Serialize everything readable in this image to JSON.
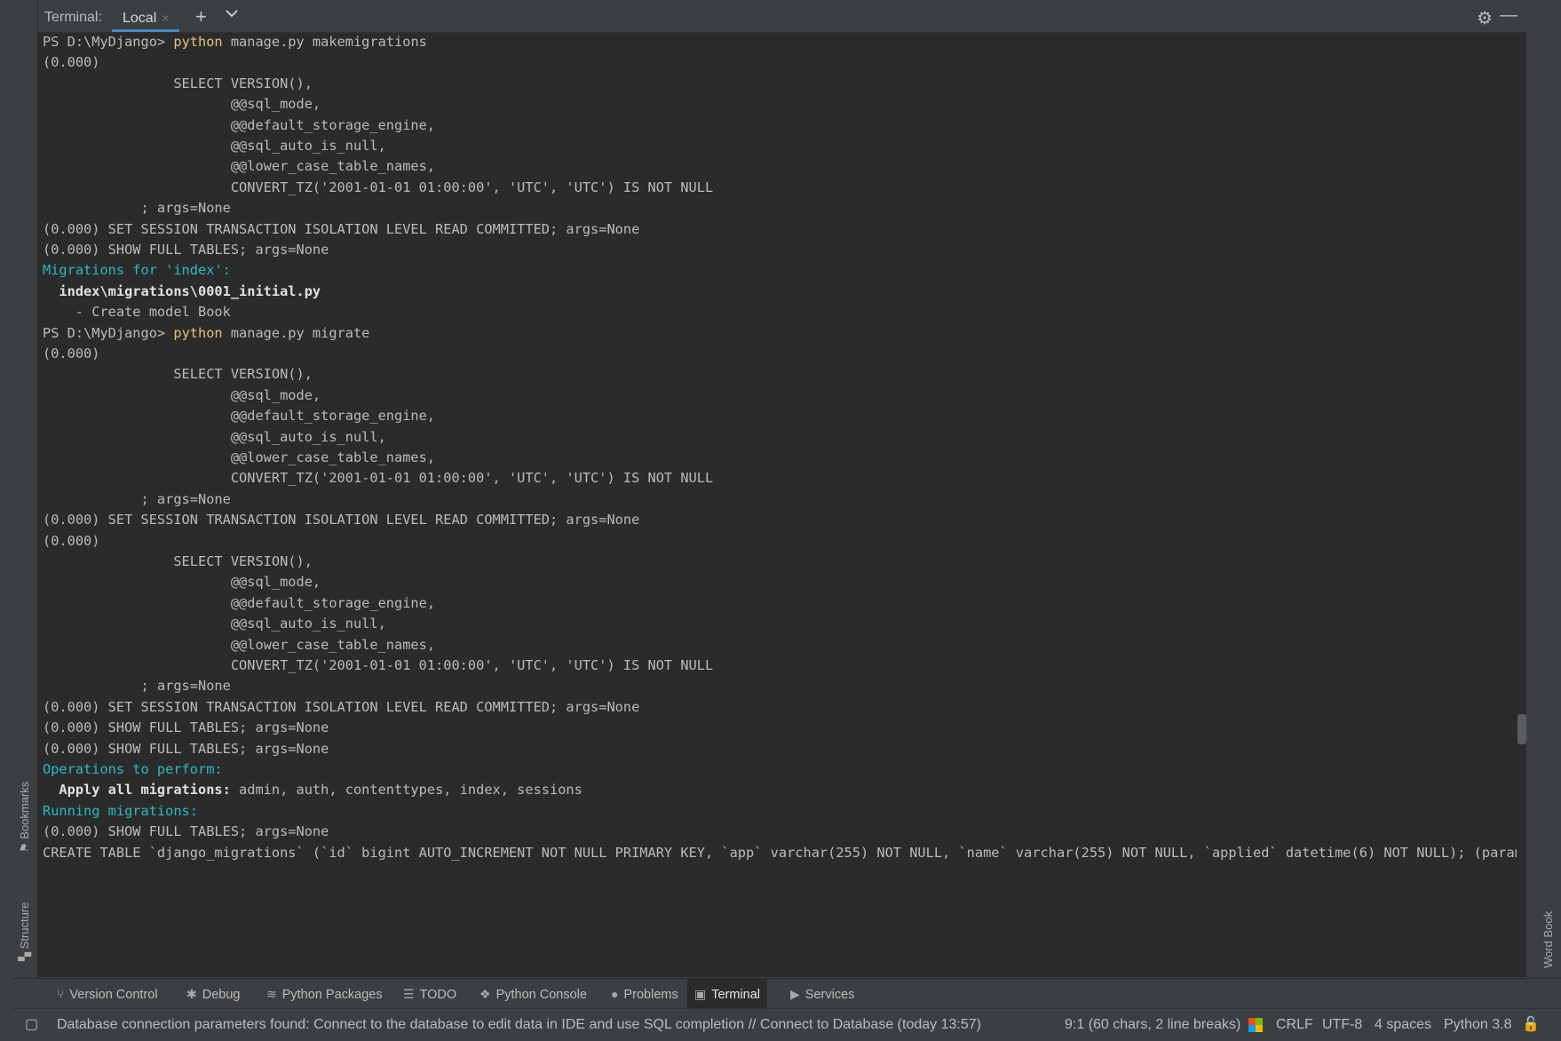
{
  "header": {
    "title": "Terminal:",
    "tab_label": "Local",
    "close_glyph": "×",
    "add_glyph": "+",
    "chevron_glyph": "⌄",
    "gear_glyph": "⚙",
    "minimize_glyph": "—"
  },
  "side_left": {
    "bookmarks": "Bookmarks",
    "structure": "Structure"
  },
  "side_right": {
    "word_book": "Word Book"
  },
  "terminal": {
    "prompt": "PS D:\\MyDjango> ",
    "cmd_word": "python",
    "cmd1_rest": " manage.py makemigrations",
    "cmd2_rest": " manage.py migrate",
    "timing": "(0.000)",
    "sel_version": "                SELECT VERSION(),",
    "sel_sql_mode": "                       @@sql_mode,",
    "sel_storage": "                       @@default_storage_engine,",
    "sel_auto": "                       @@sql_auto_is_null,",
    "sel_lower": "                       @@lower_case_table_names,",
    "sel_convert": "                       CONVERT_TZ('2001-01-01 01:00:00', 'UTC', 'UTC') IS NOT NULL",
    "args_none": "            ; args=None",
    "set_session": "(0.000) SET SESSION TRANSACTION ISOLATION LEVEL READ COMMITTED; args=None",
    "show_tables": "(0.000) SHOW FULL TABLES; args=None",
    "migrations_for": "Migrations for 'index':",
    "migration_file": "  index\\migrations\\0001_initial.py",
    "create_model": "    - Create model Book",
    "ops_to_perform": "Operations to perform:",
    "apply_all_label": "  Apply all migrations:",
    "apply_all_value": " admin, auth, contenttypes, index, sessions",
    "running_migrations": "Running migrations:",
    "create_table": "CREATE TABLE `django_migrations` (`id` bigint AUTO_INCREMENT NOT NULL PRIMARY KEY, `app` varchar(255) NOT NULL, `name` varchar(255) NOT NULL, `applied` datetime(6) NOT NULL); (params None)"
  },
  "toolwindows": {
    "version_control": "Version Control",
    "debug": "Debug",
    "python_packages": "Python Packages",
    "todo": "TODO",
    "python_console": "Python Console",
    "problems": "Problems",
    "terminal": "Terminal",
    "services": "Services"
  },
  "status": {
    "message": "Database connection parameters found: Connect to the database to edit data in IDE and use SQL completion // Connect to Database (today 13:57)",
    "position": "9:1 (60 chars, 2 line breaks)",
    "line_sep": "CRLF",
    "encoding": "UTF-8",
    "indent": "4 spaces",
    "interpreter": "Python 3.8"
  },
  "colors": {
    "terminal_bg": "#2b2b2b",
    "chrome_bg": "#3c3f41",
    "keyword": "#e5c07b",
    "highlight_cyan": "#2bbac5"
  }
}
